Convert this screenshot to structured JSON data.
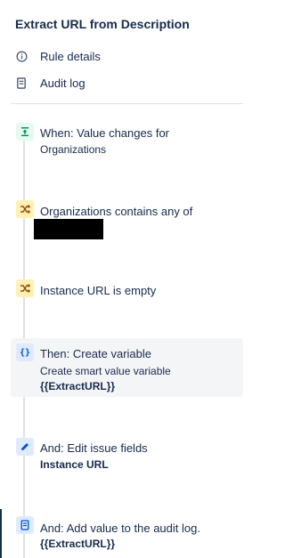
{
  "title": "Extract URL from Description",
  "menu": [
    {
      "label": "Rule details",
      "icon": "info-icon"
    },
    {
      "label": "Audit log",
      "icon": "document-icon"
    }
  ],
  "steps": [
    {
      "title": "When: Value changes for",
      "title2": "Organizations",
      "icon": "trigger-icon",
      "color": "#e3fcef",
      "icon_color": "#00875a"
    },
    {
      "title": "Organizations contains any of",
      "icon": "condition-shuffle-icon",
      "color": "#fff0b3",
      "icon_color": "#974f0c"
    },
    {
      "title": "Instance URL is empty",
      "icon": "condition-shuffle-icon",
      "color": "#fff0b3",
      "icon_color": "#974f0c"
    },
    {
      "title": "Then: Create variable",
      "sub": "Create smart value variable",
      "bold": "{{ExtractURL}}",
      "icon": "braces-icon",
      "color": "#deebff",
      "icon_color": "#0052cc"
    },
    {
      "title": "And: Edit issue fields",
      "bold": "Instance URL",
      "icon": "pencil-icon",
      "color": "#deebff",
      "icon_color": "#0052cc"
    },
    {
      "title": "And: Add value to the audit log.",
      "bold": "{{ExtractURL}}",
      "icon": "document-icon",
      "color": "#deebff",
      "icon_color": "#0052cc"
    }
  ]
}
